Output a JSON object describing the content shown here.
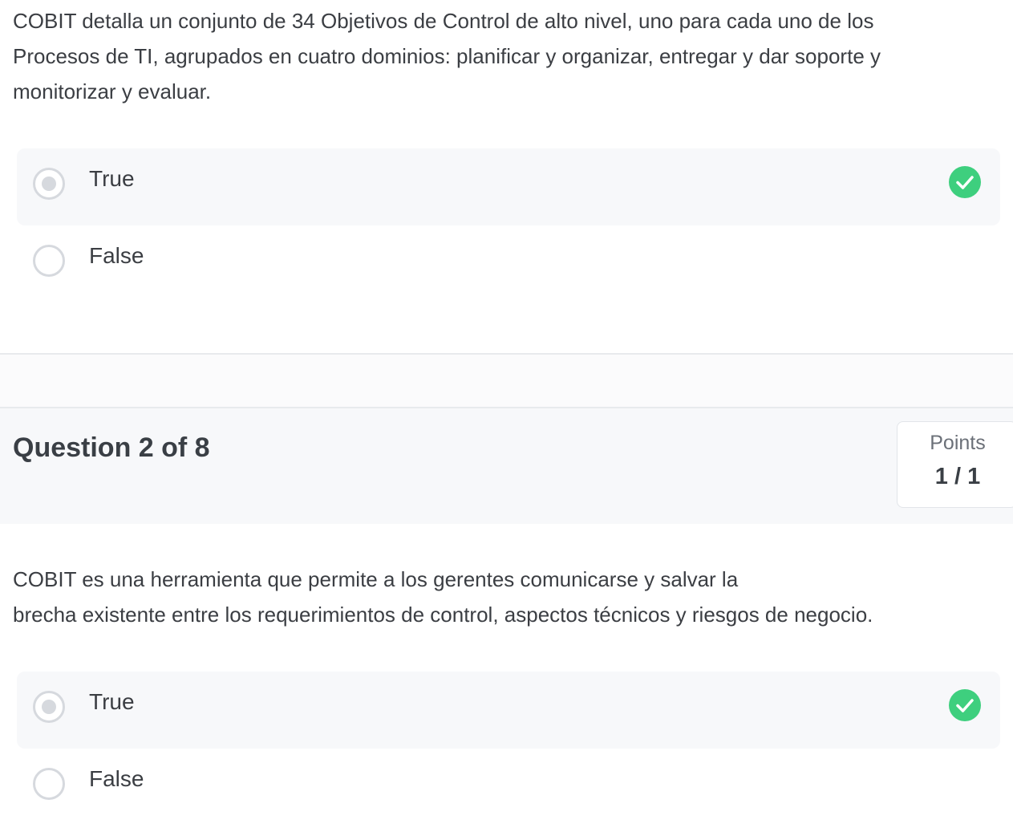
{
  "question1": {
    "text": "COBIT detalla un conjunto de 34 Objetivos de Control de alto nivel, uno para cada uno de los\nProcesos de TI, agrupados en cuatro dominios: planificar y organizar, entregar y dar soporte y\nmonitorizar y evaluar.",
    "options": [
      {
        "label": "True",
        "selected": true,
        "correct": true
      },
      {
        "label": "False",
        "selected": false,
        "correct": false
      }
    ]
  },
  "question2": {
    "title": "Question 2 of 8",
    "points_label": "Points",
    "points_value": "1 / 1",
    "text": "COBIT es una herramienta que permite a los gerentes comunicarse y salvar la\nbrecha existente entre los requerimientos de control, aspectos técnicos y riesgos de negocio.",
    "options": [
      {
        "label": "True",
        "selected": true,
        "correct": true
      },
      {
        "label": "False",
        "selected": false,
        "correct": false
      }
    ]
  },
  "colors": {
    "correct": "#3ecf7e",
    "radio_border": "#d6d9de",
    "selected_bg": "#f7f8fa"
  },
  "icons": {
    "correct": "check-circle-icon",
    "radio": "radio-button-icon"
  }
}
